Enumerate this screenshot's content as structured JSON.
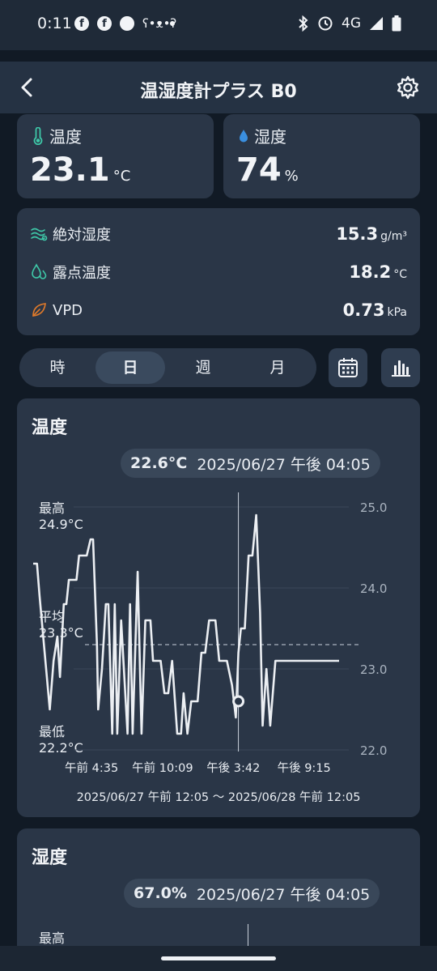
{
  "status_bar": {
    "time": "0:11",
    "network": "4G",
    "left_icons": [
      "facebook-icon",
      "facebook-icon",
      "circle-icon",
      "bear-icon",
      "dot-icon"
    ],
    "right_icons": [
      "bluetooth-icon",
      "alarm-icon",
      "signal-icon",
      "battery-icon"
    ]
  },
  "app_bar": {
    "title": "温湿度計プラス B0"
  },
  "temperature_card": {
    "label": "温度",
    "value": "23.1",
    "unit": "°C"
  },
  "humidity_card": {
    "label": "湿度",
    "value": "74",
    "unit": "%"
  },
  "details": [
    {
      "label": "絶対湿度",
      "value": "15.3",
      "unit": "g/m³",
      "icon": "wave-icon"
    },
    {
      "label": "露点温度",
      "value": "18.2",
      "unit": "°C",
      "icon": "droplets-icon"
    },
    {
      "label": "VPD",
      "value": "0.73",
      "unit": "kPa",
      "icon": "leaf-icon"
    }
  ],
  "period_tabs": [
    "時",
    "日",
    "週",
    "月"
  ],
  "active_period": "日",
  "temp_chart": {
    "title": "温度",
    "tooltip_value": "22.6°C",
    "tooltip_time": "2025/06/27 午後 04:05",
    "max_label": "最高",
    "max_value": "24.9°C",
    "avg_label": "平均",
    "avg_value": "23.3°C",
    "min_label": "最低",
    "min_value": "22.2°C",
    "range_text": "2025/06/27 午前 12:05 〜 2025/06/28 午前 12:05"
  },
  "humidity_chart": {
    "title": "湿度",
    "tooltip_value": "67.0%",
    "tooltip_time": "2025/06/27 午後 04:05",
    "max_label": "最高"
  },
  "chart_data": {
    "type": "line",
    "title": "温度",
    "xlabel": "",
    "ylabel": "",
    "ylim": [
      22.0,
      25.0
    ],
    "yticks": [
      "25.0",
      "24.0",
      "23.0",
      "22.0"
    ],
    "xticks": [
      "午前 4:35",
      "午前 10:09",
      "午後 3:42",
      "午後 9:15"
    ],
    "average": 23.3,
    "selected": {
      "time": "2025/06/27 午後 04:05",
      "value": 22.6
    },
    "grid": true,
    "series": [
      {
        "x": [
          0.0,
          0.3,
          0.5,
          0.9,
          1.3,
          1.6,
          1.9,
          2.1,
          2.4,
          2.6,
          2.8,
          3.0,
          3.4,
          3.6,
          4.2,
          4.5,
          4.7,
          5.0,
          5.1,
          5.4,
          5.7,
          5.9,
          6.2,
          6.4,
          6.6,
          6.9,
          7.4,
          7.6,
          7.8,
          8.2,
          8.5,
          8.8,
          9.2,
          9.4,
          9.6,
          10.0,
          10.3,
          10.6,
          10.9,
          11.3,
          11.6,
          11.8,
          12.1,
          12.4,
          12.6,
          12.9,
          13.2,
          13.5,
          13.8,
          14.0,
          14.3,
          14.6,
          14.9,
          15.2,
          15.6,
          15.9,
          16.1,
          16.3,
          16.6,
          16.9,
          17.2,
          17.5,
          17.8,
          18.0,
          18.3,
          18.6,
          19.0,
          19.2,
          19.5,
          19.8,
          20.0,
          20.3,
          20.6,
          20.9,
          21.2,
          21.5,
          21.9,
          22.2,
          22.5,
          22.8,
          23.1,
          23.5,
          23.8,
          24.0
        ],
        "y": [
          24.3,
          24.3,
          23.9,
          23.2,
          22.5,
          23.1,
          23.4,
          22.9,
          23.8,
          23.8,
          24.1,
          24.1,
          24.1,
          24.4,
          24.4,
          24.6,
          24.6,
          23.3,
          22.5,
          23.0,
          23.8,
          23.8,
          22.2,
          23.8,
          22.2,
          23.6,
          22.2,
          23.8,
          22.2,
          24.2,
          22.2,
          23.6,
          23.6,
          23.1,
          23.1,
          23.1,
          22.7,
          22.7,
          23.1,
          22.2,
          22.2,
          22.7,
          22.2,
          22.6,
          22.6,
          22.6,
          23.2,
          23.2,
          23.6,
          23.6,
          23.6,
          23.1,
          23.1,
          23.1,
          22.8,
          22.4,
          23.2,
          23.5,
          23.5,
          24.4,
          24.4,
          24.9,
          23.7,
          22.3,
          23.0,
          22.3,
          23.1,
          23.1,
          23.1,
          23.1,
          23.1,
          23.1,
          23.1,
          23.1,
          23.1,
          23.1,
          23.1,
          23.1,
          23.1,
          23.1,
          23.1,
          23.1,
          23.1,
          23.1
        ]
      }
    ]
  }
}
